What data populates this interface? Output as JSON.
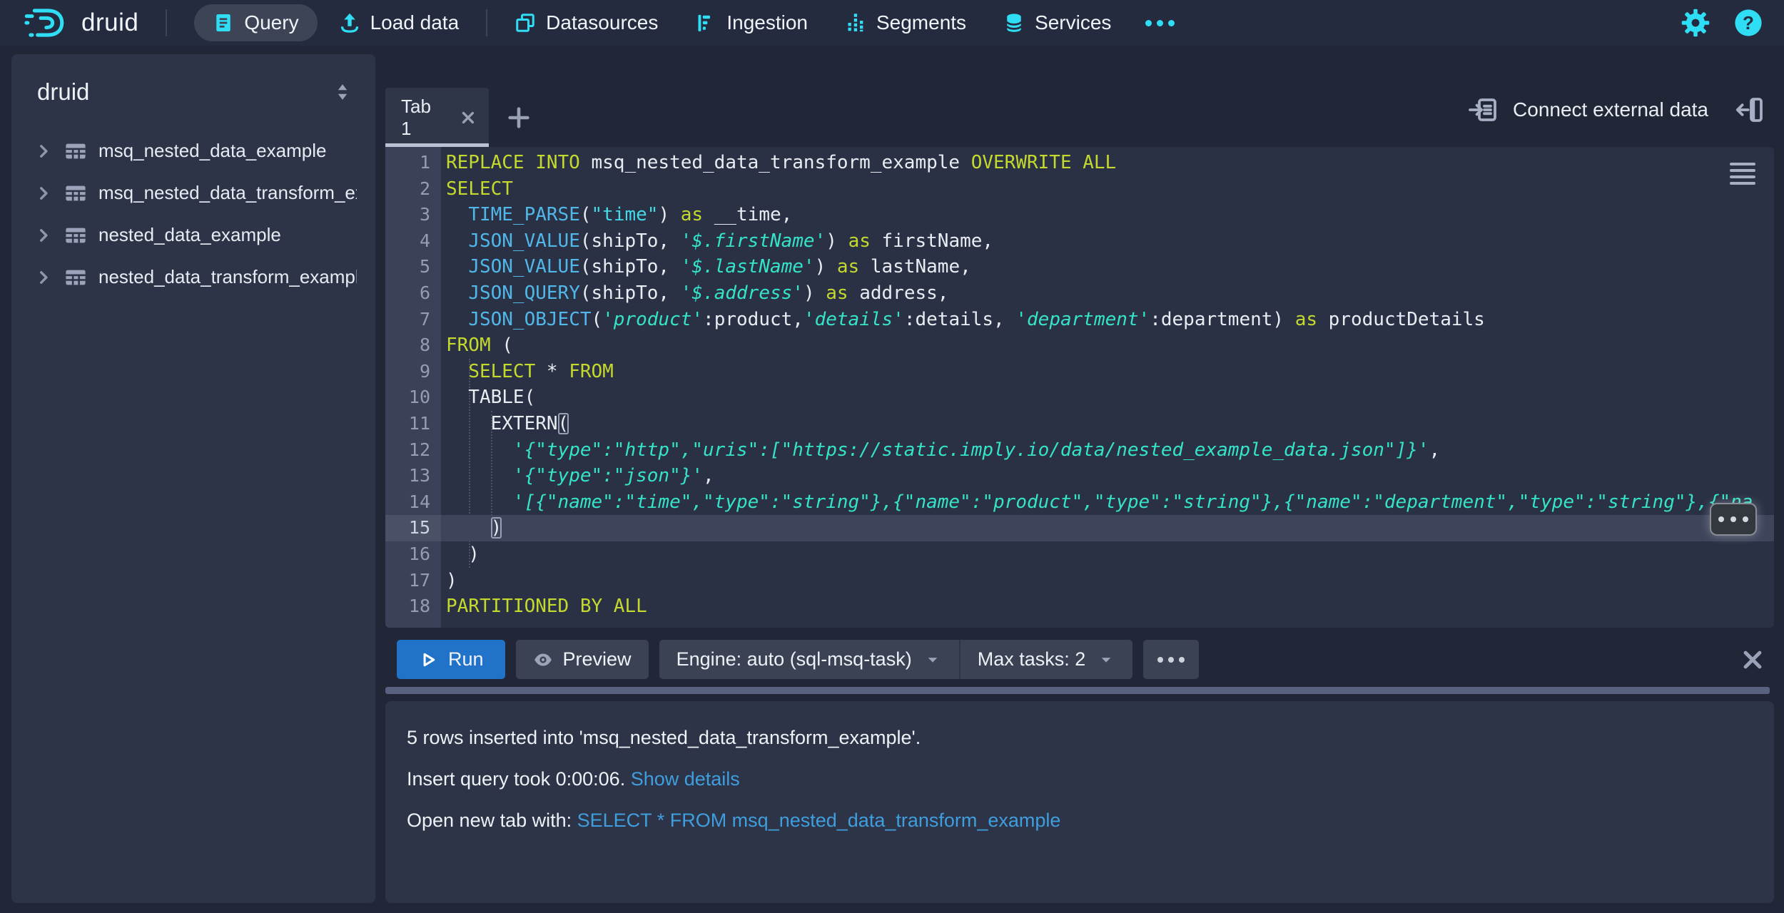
{
  "navbar": {
    "logo_text": "druid",
    "query": "Query",
    "load_data": "Load data",
    "datasources": "Datasources",
    "ingestion": "Ingestion",
    "segments": "Segments",
    "services": "Services"
  },
  "sidebar": {
    "schema": "druid",
    "tables": [
      "msq_nested_data_example",
      "msq_nested_data_transform_ex",
      "nested_data_example",
      "nested_data_transform_exampl"
    ]
  },
  "tabbar": {
    "tab": "Tab 1",
    "connect": "Connect external data"
  },
  "editor": {
    "active_line": 15,
    "lines": [
      {
        "seg": [
          [
            "k",
            "REPLACE INTO"
          ],
          [
            "p",
            " msq_nested_data_transform_example "
          ],
          [
            "k",
            "OVERWRITE ALL"
          ]
        ]
      },
      {
        "seg": [
          [
            "k",
            "SELECT"
          ]
        ]
      },
      {
        "seg": [
          [
            "p",
            "  "
          ],
          [
            "f",
            "TIME_PARSE"
          ],
          [
            "p",
            "("
          ],
          [
            "d",
            "\"time\""
          ],
          [
            "p",
            ") "
          ],
          [
            "k",
            "as"
          ],
          [
            "p",
            " __time,"
          ]
        ]
      },
      {
        "seg": [
          [
            "p",
            "  "
          ],
          [
            "f",
            "JSON_VALUE"
          ],
          [
            "p",
            "(shipTo, "
          ],
          [
            "s",
            "'$.firstName'"
          ],
          [
            "p",
            ") "
          ],
          [
            "k",
            "as"
          ],
          [
            "p",
            " firstName,"
          ]
        ]
      },
      {
        "seg": [
          [
            "p",
            "  "
          ],
          [
            "f",
            "JSON_VALUE"
          ],
          [
            "p",
            "(shipTo, "
          ],
          [
            "s",
            "'$.lastName'"
          ],
          [
            "p",
            ") "
          ],
          [
            "k",
            "as"
          ],
          [
            "p",
            " lastName,"
          ]
        ]
      },
      {
        "seg": [
          [
            "p",
            "  "
          ],
          [
            "f",
            "JSON_QUERY"
          ],
          [
            "p",
            "(shipTo, "
          ],
          [
            "s",
            "'$.address'"
          ],
          [
            "p",
            ") "
          ],
          [
            "k",
            "as"
          ],
          [
            "p",
            " address,"
          ]
        ]
      },
      {
        "seg": [
          [
            "p",
            "  "
          ],
          [
            "f",
            "JSON_OBJECT"
          ],
          [
            "p",
            "("
          ],
          [
            "s",
            "'product'"
          ],
          [
            "p",
            ":product,"
          ],
          [
            "s",
            "'details'"
          ],
          [
            "p",
            ":details, "
          ],
          [
            "s",
            "'department'"
          ],
          [
            "p",
            ":department) "
          ],
          [
            "k",
            "as"
          ],
          [
            "p",
            " productDetails"
          ]
        ]
      },
      {
        "seg": [
          [
            "k",
            "FROM"
          ],
          [
            "p",
            " ("
          ]
        ]
      },
      {
        "seg": [
          [
            "p",
            "  "
          ],
          [
            "k",
            "SELECT"
          ],
          [
            "p",
            " * "
          ],
          [
            "k",
            "FROM"
          ]
        ]
      },
      {
        "seg": [
          [
            "p",
            "  TABLE("
          ]
        ]
      },
      {
        "seg": [
          [
            "p",
            "    EXTERN"
          ],
          [
            "b",
            "("
          ]
        ]
      },
      {
        "seg": [
          [
            "p",
            "      "
          ],
          [
            "s",
            "'{\"type\":\"http\",\"uris\":[\"https://static.imply.io/data/nested_example_data.json\"]}'"
          ],
          [
            "p",
            ","
          ]
        ]
      },
      {
        "seg": [
          [
            "p",
            "      "
          ],
          [
            "s",
            "'{\"type\":\"json\"}'"
          ],
          [
            "p",
            ","
          ]
        ]
      },
      {
        "seg": [
          [
            "p",
            "      "
          ],
          [
            "s",
            "'[{\"name\":\"time\",\"type\":\"string\"},{\"name\":\"product\",\"type\":\"string\"},{\"name\":\"department\",\"type\":\"string\"},{\"na"
          ]
        ]
      },
      {
        "seg": [
          [
            "p",
            "    "
          ],
          [
            "b",
            ")"
          ]
        ]
      },
      {
        "seg": [
          [
            "p",
            "  )"
          ]
        ]
      },
      {
        "seg": [
          [
            "p",
            ")"
          ]
        ]
      },
      {
        "seg": [
          [
            "k",
            "PARTITIONED BY ALL"
          ]
        ]
      }
    ]
  },
  "runbar": {
    "run": "Run",
    "preview": "Preview",
    "engine": "Engine: auto (sql-msq-task)",
    "max_tasks": "Max tasks: 2"
  },
  "results": {
    "inserted": "5 rows inserted into 'msq_nested_data_transform_example'.",
    "took_prefix": "Insert query took 0:00:06. ",
    "details_link": "Show details",
    "open_prefix": "Open new tab with: ",
    "open_link": "SELECT * FROM msq_nested_data_transform_example"
  },
  "colors": {
    "accent_cyan": "#2fdef5",
    "run_button_blue": "#2173c9",
    "link_blue": "#3f9ede",
    "keyword_yellow": "#c3d92e",
    "function_blue": "#50b7e8",
    "string_teal": "#35e3c9"
  }
}
